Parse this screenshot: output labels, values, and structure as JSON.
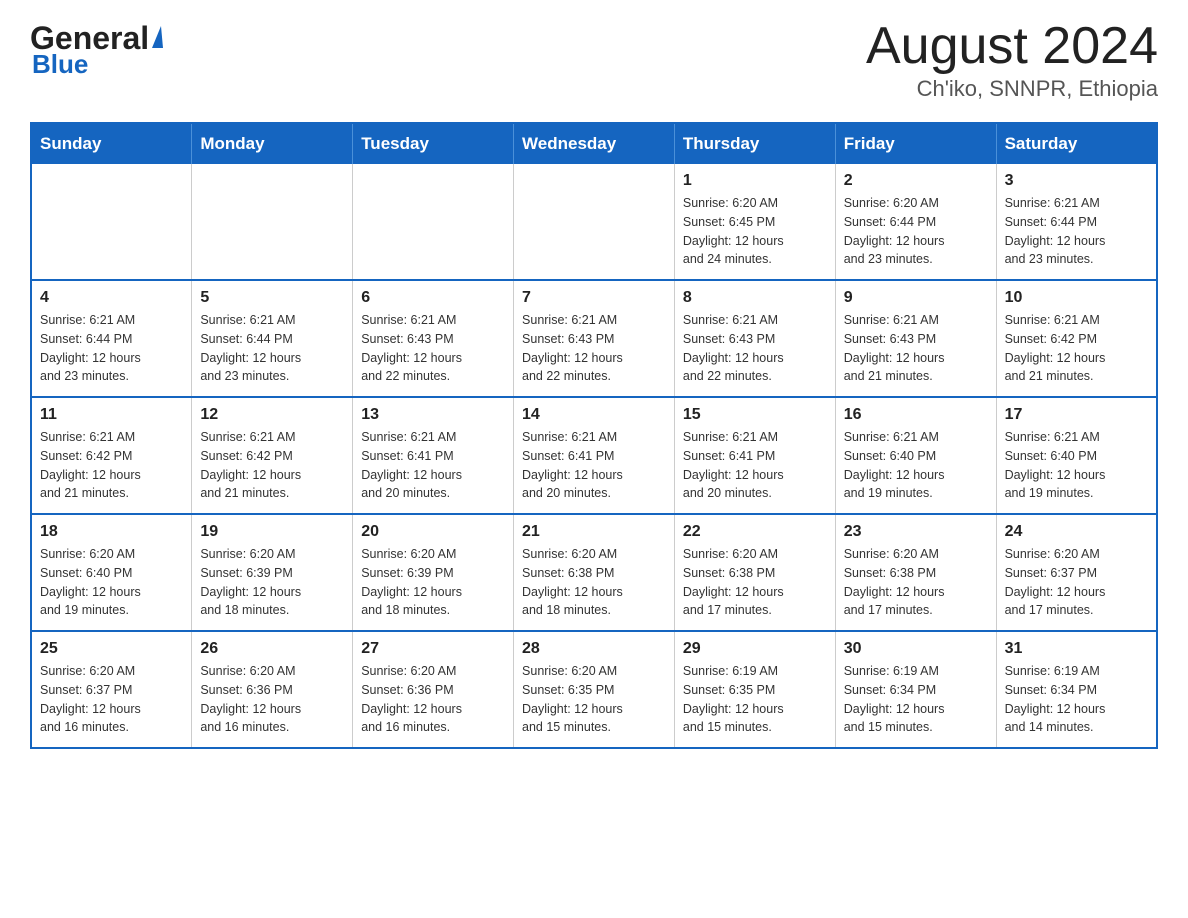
{
  "header": {
    "logo_line1": "General",
    "logo_line2": "Blue",
    "month_title": "August 2024",
    "location": "Ch'iko, SNNPR, Ethiopia"
  },
  "weekdays": [
    "Sunday",
    "Monday",
    "Tuesday",
    "Wednesday",
    "Thursday",
    "Friday",
    "Saturday"
  ],
  "weeks": [
    [
      {
        "day": "",
        "info": ""
      },
      {
        "day": "",
        "info": ""
      },
      {
        "day": "",
        "info": ""
      },
      {
        "day": "",
        "info": ""
      },
      {
        "day": "1",
        "info": "Sunrise: 6:20 AM\nSunset: 6:45 PM\nDaylight: 12 hours\nand 24 minutes."
      },
      {
        "day": "2",
        "info": "Sunrise: 6:20 AM\nSunset: 6:44 PM\nDaylight: 12 hours\nand 23 minutes."
      },
      {
        "day": "3",
        "info": "Sunrise: 6:21 AM\nSunset: 6:44 PM\nDaylight: 12 hours\nand 23 minutes."
      }
    ],
    [
      {
        "day": "4",
        "info": "Sunrise: 6:21 AM\nSunset: 6:44 PM\nDaylight: 12 hours\nand 23 minutes."
      },
      {
        "day": "5",
        "info": "Sunrise: 6:21 AM\nSunset: 6:44 PM\nDaylight: 12 hours\nand 23 minutes."
      },
      {
        "day": "6",
        "info": "Sunrise: 6:21 AM\nSunset: 6:43 PM\nDaylight: 12 hours\nand 22 minutes."
      },
      {
        "day": "7",
        "info": "Sunrise: 6:21 AM\nSunset: 6:43 PM\nDaylight: 12 hours\nand 22 minutes."
      },
      {
        "day": "8",
        "info": "Sunrise: 6:21 AM\nSunset: 6:43 PM\nDaylight: 12 hours\nand 22 minutes."
      },
      {
        "day": "9",
        "info": "Sunrise: 6:21 AM\nSunset: 6:43 PM\nDaylight: 12 hours\nand 21 minutes."
      },
      {
        "day": "10",
        "info": "Sunrise: 6:21 AM\nSunset: 6:42 PM\nDaylight: 12 hours\nand 21 minutes."
      }
    ],
    [
      {
        "day": "11",
        "info": "Sunrise: 6:21 AM\nSunset: 6:42 PM\nDaylight: 12 hours\nand 21 minutes."
      },
      {
        "day": "12",
        "info": "Sunrise: 6:21 AM\nSunset: 6:42 PM\nDaylight: 12 hours\nand 21 minutes."
      },
      {
        "day": "13",
        "info": "Sunrise: 6:21 AM\nSunset: 6:41 PM\nDaylight: 12 hours\nand 20 minutes."
      },
      {
        "day": "14",
        "info": "Sunrise: 6:21 AM\nSunset: 6:41 PM\nDaylight: 12 hours\nand 20 minutes."
      },
      {
        "day": "15",
        "info": "Sunrise: 6:21 AM\nSunset: 6:41 PM\nDaylight: 12 hours\nand 20 minutes."
      },
      {
        "day": "16",
        "info": "Sunrise: 6:21 AM\nSunset: 6:40 PM\nDaylight: 12 hours\nand 19 minutes."
      },
      {
        "day": "17",
        "info": "Sunrise: 6:21 AM\nSunset: 6:40 PM\nDaylight: 12 hours\nand 19 minutes."
      }
    ],
    [
      {
        "day": "18",
        "info": "Sunrise: 6:20 AM\nSunset: 6:40 PM\nDaylight: 12 hours\nand 19 minutes."
      },
      {
        "day": "19",
        "info": "Sunrise: 6:20 AM\nSunset: 6:39 PM\nDaylight: 12 hours\nand 18 minutes."
      },
      {
        "day": "20",
        "info": "Sunrise: 6:20 AM\nSunset: 6:39 PM\nDaylight: 12 hours\nand 18 minutes."
      },
      {
        "day": "21",
        "info": "Sunrise: 6:20 AM\nSunset: 6:38 PM\nDaylight: 12 hours\nand 18 minutes."
      },
      {
        "day": "22",
        "info": "Sunrise: 6:20 AM\nSunset: 6:38 PM\nDaylight: 12 hours\nand 17 minutes."
      },
      {
        "day": "23",
        "info": "Sunrise: 6:20 AM\nSunset: 6:38 PM\nDaylight: 12 hours\nand 17 minutes."
      },
      {
        "day": "24",
        "info": "Sunrise: 6:20 AM\nSunset: 6:37 PM\nDaylight: 12 hours\nand 17 minutes."
      }
    ],
    [
      {
        "day": "25",
        "info": "Sunrise: 6:20 AM\nSunset: 6:37 PM\nDaylight: 12 hours\nand 16 minutes."
      },
      {
        "day": "26",
        "info": "Sunrise: 6:20 AM\nSunset: 6:36 PM\nDaylight: 12 hours\nand 16 minutes."
      },
      {
        "day": "27",
        "info": "Sunrise: 6:20 AM\nSunset: 6:36 PM\nDaylight: 12 hours\nand 16 minutes."
      },
      {
        "day": "28",
        "info": "Sunrise: 6:20 AM\nSunset: 6:35 PM\nDaylight: 12 hours\nand 15 minutes."
      },
      {
        "day": "29",
        "info": "Sunrise: 6:19 AM\nSunset: 6:35 PM\nDaylight: 12 hours\nand 15 minutes."
      },
      {
        "day": "30",
        "info": "Sunrise: 6:19 AM\nSunset: 6:34 PM\nDaylight: 12 hours\nand 15 minutes."
      },
      {
        "day": "31",
        "info": "Sunrise: 6:19 AM\nSunset: 6:34 PM\nDaylight: 12 hours\nand 14 minutes."
      }
    ]
  ]
}
